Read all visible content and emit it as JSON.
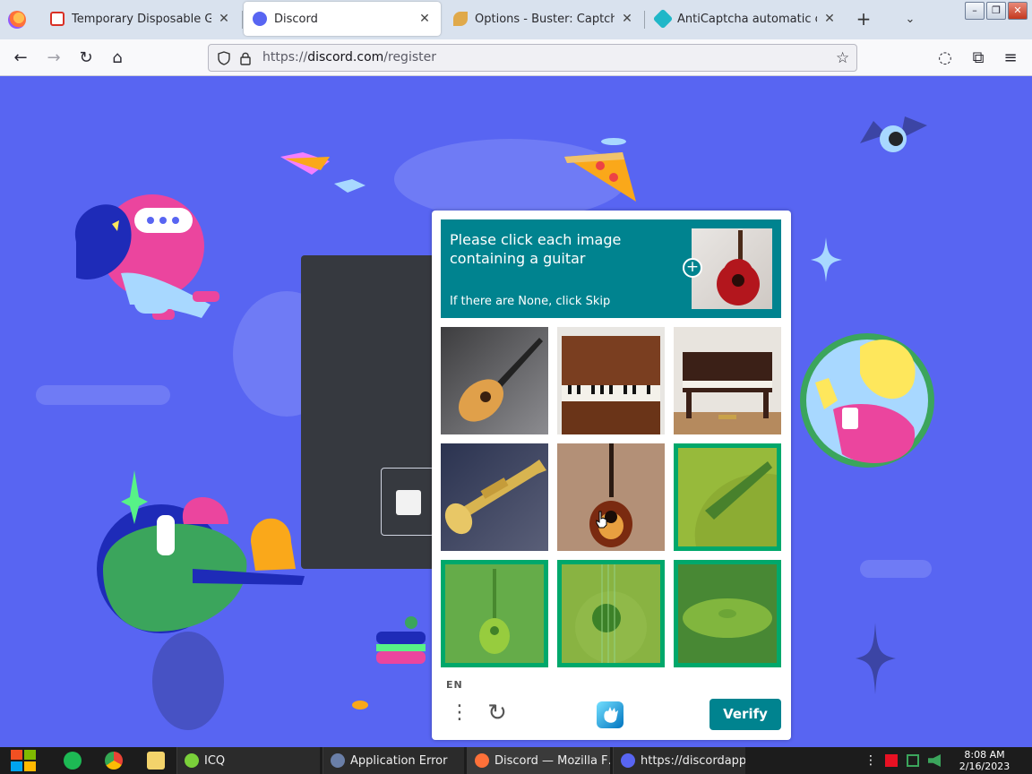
{
  "tabs": [
    {
      "label": "Temporary Disposable Gmail | …",
      "active": false,
      "icon": "gmail-icon"
    },
    {
      "label": "Discord",
      "active": true,
      "icon": "discord-icon"
    },
    {
      "label": "Options - Buster: Captcha Sol…",
      "active": false,
      "icon": "buster-icon"
    },
    {
      "label": "AntiCaptcha automatic captcha …",
      "active": false,
      "icon": "anticaptcha-icon"
    }
  ],
  "tab_close_glyph": "✕",
  "new_tab_glyph": "+",
  "tab_list_glyph": "⌄",
  "window_controls": {
    "minimize": "–",
    "restore": "❐",
    "close": "✕"
  },
  "nav": {
    "back_glyph": "←",
    "forward_glyph": "→",
    "reload_glyph": "↻",
    "home_glyph": "⌂",
    "url_scheme": "https://",
    "url_host": "discord.com",
    "url_path": "/register",
    "bookmark_glyph": "☆",
    "pocket_glyph": "◌",
    "extensions_glyph": "⧉",
    "menu_glyph": "≡"
  },
  "captcha": {
    "prompt": "Please click each image containing a guitar",
    "sub_prompt": "If there are None, click Skip",
    "language": "EN",
    "menu_glyph": "⋮",
    "refresh_glyph": "↻",
    "verify_label": "Verify",
    "tiles": [
      {
        "subject": "acoustic-guitar",
        "selected": false
      },
      {
        "subject": "upright-piano",
        "selected": false
      },
      {
        "subject": "upright-piano-dark",
        "selected": false
      },
      {
        "subject": "trumpet",
        "selected": false
      },
      {
        "subject": "acoustic-guitar-sunburst",
        "selected": false
      },
      {
        "subject": "guitar-closeup",
        "selected": true
      },
      {
        "subject": "guitar-yellow",
        "selected": true
      },
      {
        "subject": "guitar-soundhole",
        "selected": true
      },
      {
        "subject": "cymbal",
        "selected": true
      }
    ]
  },
  "taskbar": {
    "items": [
      {
        "label": "ICQ",
        "icon": "icq-icon"
      },
      {
        "label": "Application Error",
        "icon": "app-error-icon"
      },
      {
        "label": "Discord — Mozilla F…",
        "icon": "firefox-icon"
      },
      {
        "label": "https://discordapp.c…",
        "icon": "discord-icon"
      }
    ],
    "clock_time": "8:08 AM",
    "clock_date": "2/16/2023"
  },
  "colors": {
    "discord_blurple": "#5865f2",
    "hcaptcha_teal": "#00838f",
    "selection_green": "#00a86b"
  }
}
